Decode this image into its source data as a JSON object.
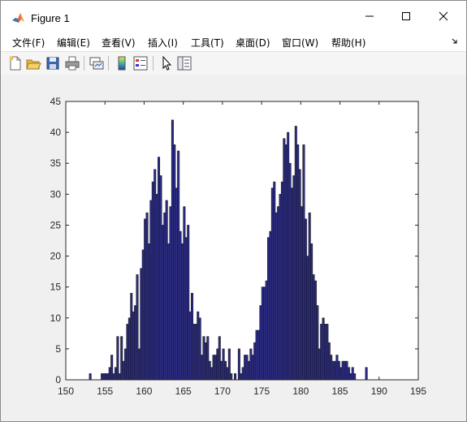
{
  "window": {
    "title": "Figure 1",
    "icon": "matlab-logo-icon",
    "controls": [
      "minimize-icon",
      "maximize-icon",
      "close-icon"
    ]
  },
  "menu": {
    "items": [
      "文件(F)",
      "编辑(E)",
      "查看(V)",
      "插入(I)",
      "工具(T)",
      "桌面(D)",
      "窗口(W)",
      "帮助(H)"
    ]
  },
  "toolbar": {
    "buttons": [
      "new-figure-icon",
      "open-file-icon",
      "save-icon",
      "print-icon",
      "link-plot-icon",
      "colorbar-icon",
      "legend-icon",
      "pointer-icon",
      "property-editor-icon"
    ]
  },
  "colors": {
    "bar_fill": "#2b2b8a",
    "bar_edge": "#1a1a1a",
    "axes_bg": "#ffffff",
    "figure_bg": "#f0f0f0"
  },
  "chart_data": {
    "type": "bar",
    "subtype": "histogram",
    "title": "",
    "xlabel": "",
    "ylabel": "",
    "xlim": [
      150,
      195
    ],
    "ylim": [
      0,
      45
    ],
    "xticks": [
      "150",
      "155",
      "160",
      "165",
      "170",
      "175",
      "180",
      "185",
      "190",
      "195"
    ],
    "yticks": [
      "0",
      "5",
      "10",
      "15",
      "20",
      "25",
      "30",
      "35",
      "40",
      "45"
    ],
    "bin_start": 153.0,
    "bin_width": 0.25,
    "counts": [
      1,
      0,
      0,
      0,
      0,
      0,
      1,
      1,
      1,
      1,
      2,
      4,
      1,
      2,
      7,
      1,
      7,
      3,
      5,
      9,
      10,
      14,
      11,
      12,
      17,
      5,
      18,
      21,
      26,
      27,
      22,
      29,
      32,
      34,
      30,
      36,
      33,
      25,
      27,
      29,
      22,
      28,
      42,
      38,
      31,
      37,
      24,
      22,
      28,
      23,
      25,
      11,
      14,
      9,
      9,
      11,
      10,
      4,
      7,
      6,
      7,
      3,
      2,
      4,
      4,
      5,
      7,
      3,
      5,
      3,
      2,
      5,
      1,
      0,
      1,
      0,
      5,
      1,
      2,
      4,
      4,
      3,
      5,
      4,
      6,
      8,
      8,
      12,
      15,
      15,
      16,
      23,
      24,
      31,
      32,
      27,
      28,
      30,
      32,
      39,
      38,
      40,
      35,
      31,
      33,
      41,
      38,
      34,
      28,
      38,
      26,
      20,
      27,
      22,
      17,
      16,
      12,
      5,
      9,
      10,
      9,
      9,
      6,
      4,
      3,
      3,
      4,
      3,
      2,
      3,
      3,
      3,
      2,
      1,
      2,
      1,
      0,
      0,
      0,
      0,
      0,
      2
    ],
    "grid": false,
    "legend": "none"
  }
}
